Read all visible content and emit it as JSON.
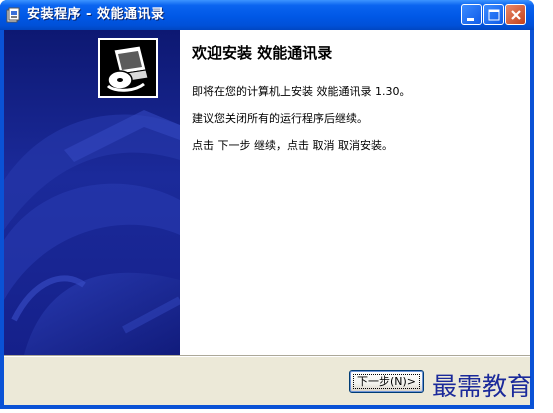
{
  "window": {
    "title": "安装程序 - 效能通讯录"
  },
  "welcome": {
    "heading": "欢迎安装 效能通讯录",
    "paragraphs": [
      "即将在您的计算机上安装 效能通讯录 1.30。",
      "建议您关闭所有的运行程序后继续。",
      "点击 下一步 继续，点击 取消 取消安装。"
    ]
  },
  "buttons": {
    "next_label": "下一步(N)>"
  },
  "watermark": {
    "text": "最需教育"
  },
  "icons": {
    "title": "installer-icon",
    "logo": "computer-disk-logo-icon"
  },
  "colors": {
    "titlebar": "#0058E6",
    "sidebar": "#1B2A9A",
    "footer": "#ECE9D8",
    "watermark": "#1B2A9A"
  }
}
